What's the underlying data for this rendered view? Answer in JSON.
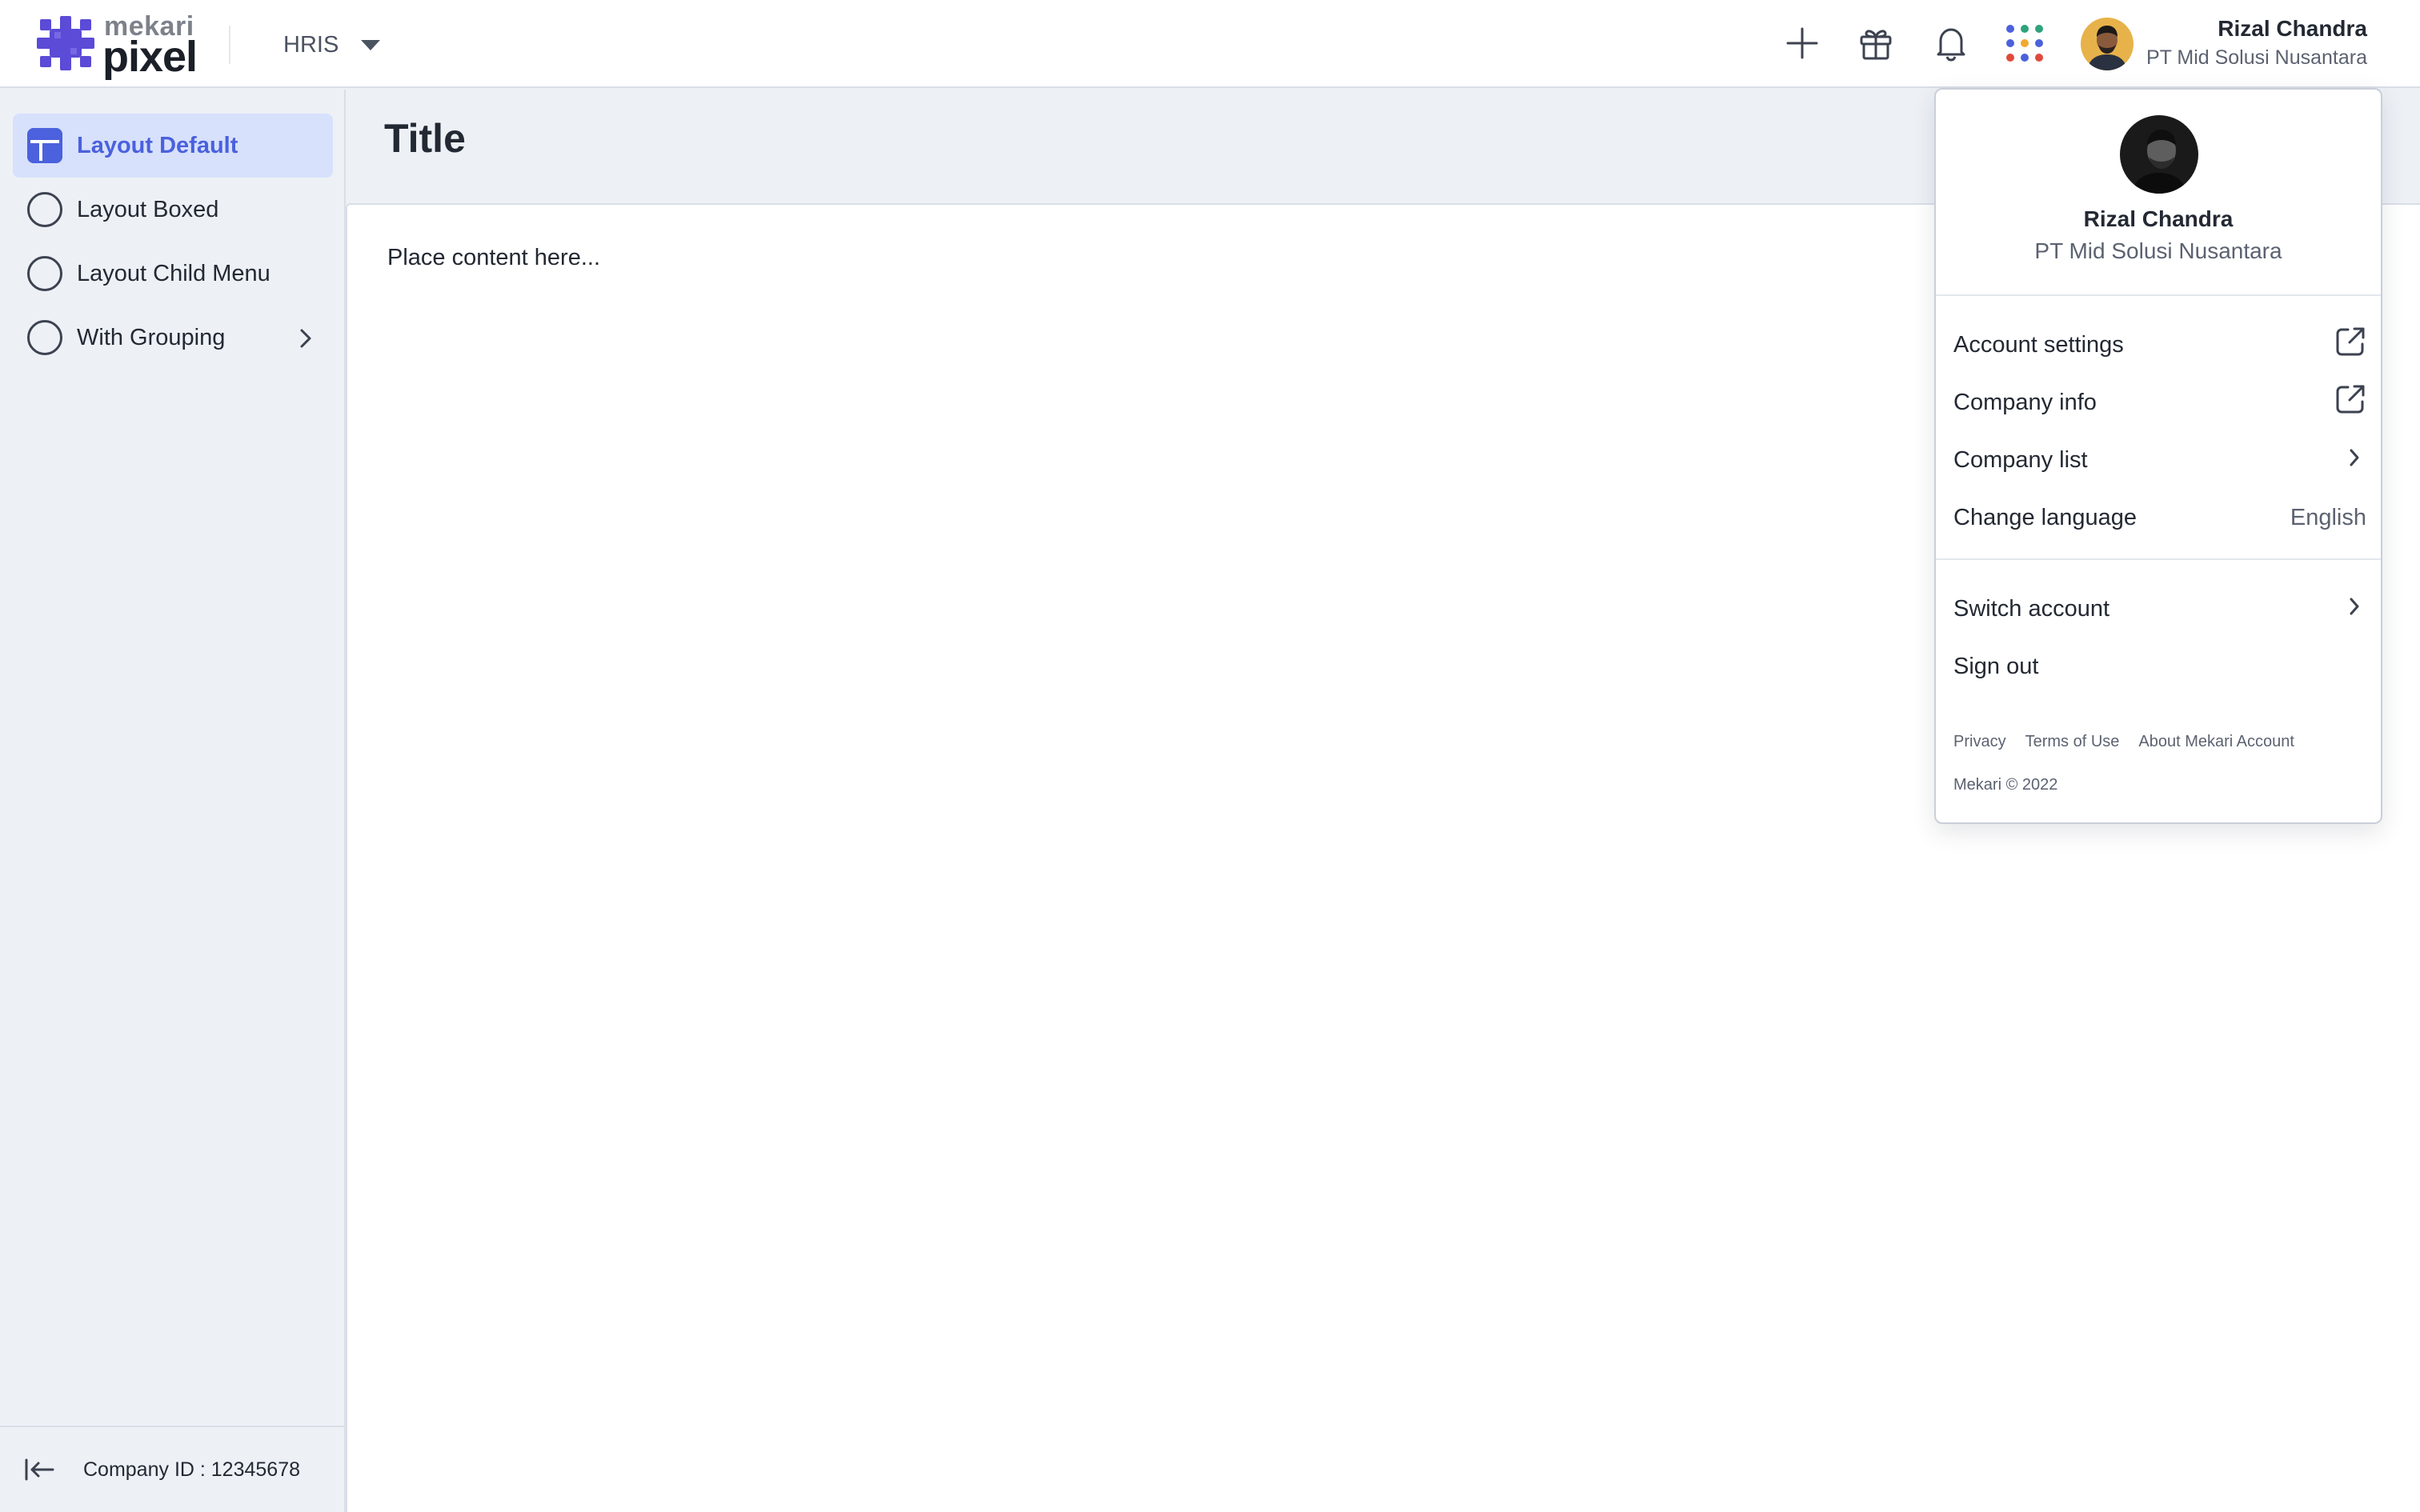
{
  "brand": {
    "small": "mekari",
    "big": "pixel"
  },
  "product_switcher": {
    "label": "HRIS"
  },
  "user": {
    "name": "Rizal Chandra",
    "company": "PT Mid Solusi Nusantara"
  },
  "sidebar": {
    "items": [
      {
        "label": "Layout Default",
        "active": true
      },
      {
        "label": "Layout Boxed",
        "active": false
      },
      {
        "label": "Layout Child Menu",
        "active": false
      },
      {
        "label": "With Grouping",
        "active": false,
        "has_children": true
      }
    ],
    "footer": "Company ID : 12345678"
  },
  "page": {
    "title": "Title",
    "content": "Place content here..."
  },
  "account_menu": {
    "name": "Rizal Chandra",
    "company": "PT Mid Solusi Nusantara",
    "items": [
      {
        "label": "Account settings",
        "trailing": "external-link-icon"
      },
      {
        "label": "Company info",
        "trailing": "external-link-icon"
      },
      {
        "label": "Company list",
        "trailing": "chevron-right-icon"
      },
      {
        "label": "Change language",
        "value": "English"
      },
      {
        "label": "Switch account",
        "trailing": "chevron-right-icon"
      },
      {
        "label": "Sign out"
      }
    ],
    "links": [
      "Privacy",
      "Terms of Use",
      "About Mekari Account"
    ],
    "copyright": "Mekari © 2022"
  },
  "colors": {
    "accent": "#4b61dd",
    "active_bg": "#d7e1fc",
    "page_bg": "#edf1f6"
  }
}
